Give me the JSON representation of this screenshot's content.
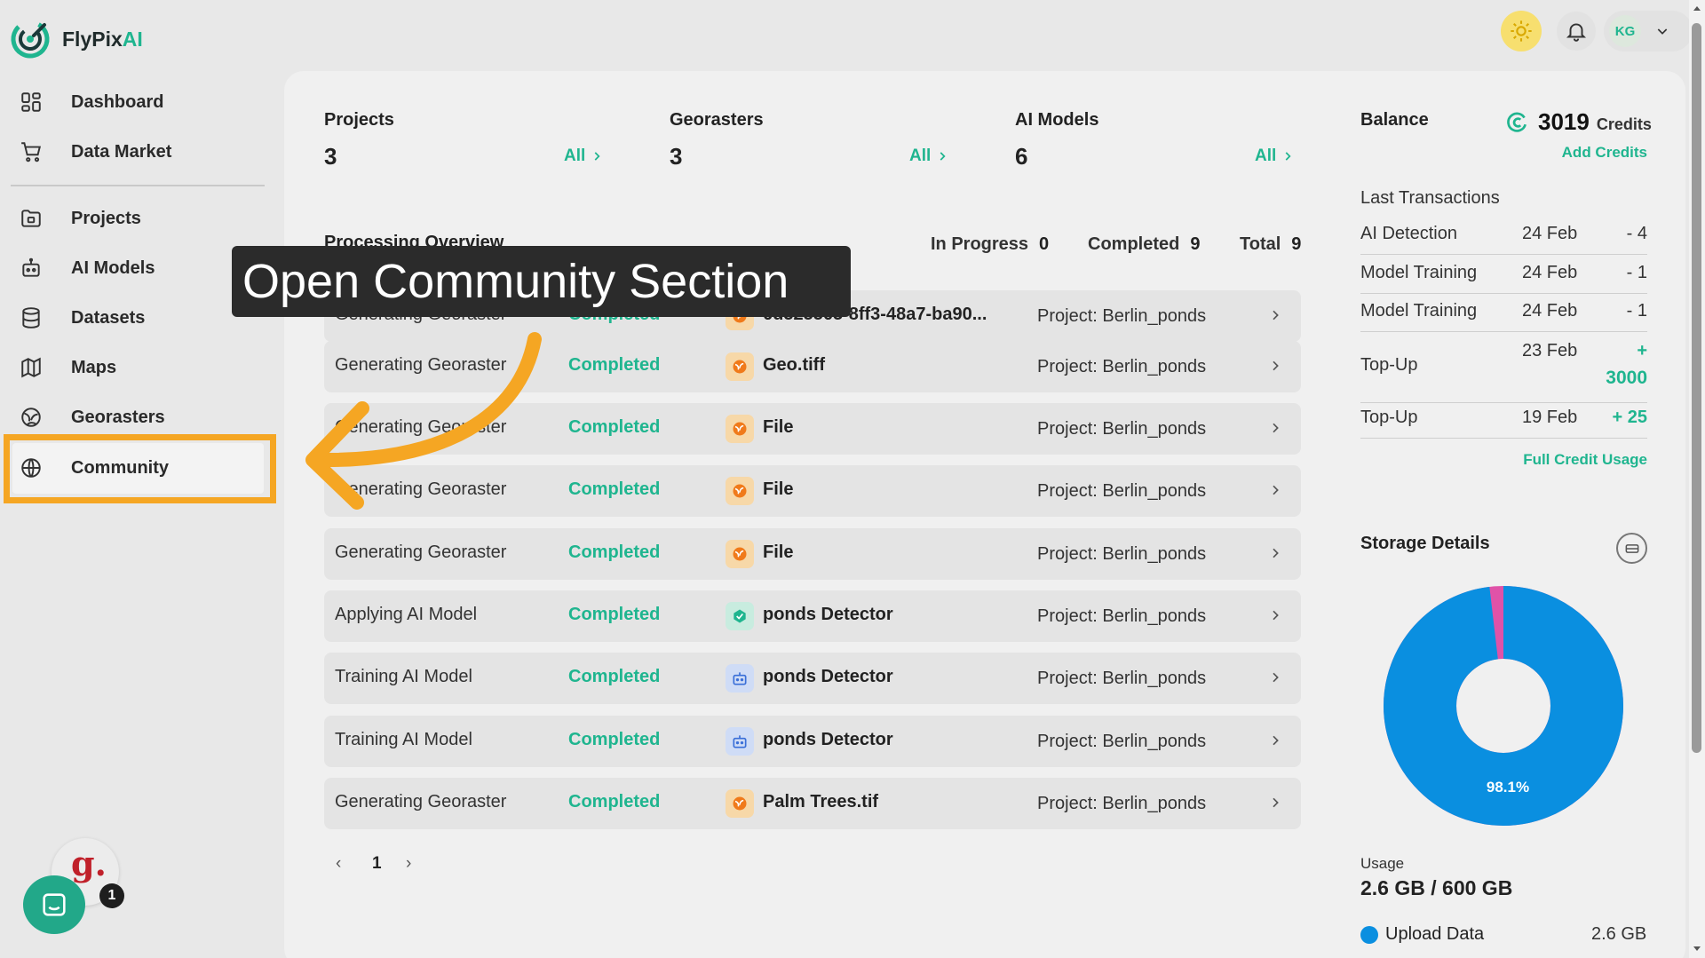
{
  "brand": {
    "name": "FlyPix",
    "name_ai": "AI"
  },
  "sidebar": {
    "items": [
      {
        "label": "Dashboard",
        "icon": "dashboard-icon"
      },
      {
        "label": "Data Market",
        "icon": "cart-icon"
      },
      {
        "label": "Projects",
        "icon": "folder-icon"
      },
      {
        "label": "AI Models",
        "icon": "robot-icon"
      },
      {
        "label": "Datasets",
        "icon": "database-icon"
      },
      {
        "label": "Maps",
        "icon": "map-icon"
      },
      {
        "label": "Georasters",
        "icon": "globe-grid-icon"
      },
      {
        "label": "Community",
        "icon": "globe-icon"
      }
    ]
  },
  "stats": [
    {
      "title": "Projects",
      "value": "3",
      "link": "All"
    },
    {
      "title": "Georasters",
      "value": "3",
      "link": "All"
    },
    {
      "title": "AI Models",
      "value": "6",
      "link": "All"
    }
  ],
  "processing": {
    "title": "Processing Overview",
    "in_progress_label": "In Progress",
    "in_progress": "0",
    "completed_label": "Completed",
    "completed": "9",
    "total_label": "Total",
    "total": "9",
    "rows": [
      {
        "task": "Generating Georaster",
        "status": "Completed",
        "file": "6d323363-8ff3-48a7-ba90...",
        "type": "georaster",
        "project": "Project: Berlin_ponds"
      },
      {
        "task": "Generating Georaster",
        "status": "Completed",
        "file": "Geo.tiff",
        "type": "georaster",
        "project": "Project: Berlin_ponds"
      },
      {
        "task": "Generating Georaster",
        "status": "Completed",
        "file": "File",
        "type": "georaster",
        "project": "Project: Berlin_ponds"
      },
      {
        "task": "Generating Georaster",
        "status": "Completed",
        "file": "File",
        "type": "georaster",
        "project": "Project: Berlin_ponds"
      },
      {
        "task": "Generating Georaster",
        "status": "Completed",
        "file": "File",
        "type": "georaster",
        "project": "Project: Berlin_ponds"
      },
      {
        "task": "Applying AI Model",
        "status": "Completed",
        "file": "ponds Detector",
        "type": "apply",
        "project": "Project: Berlin_ponds"
      },
      {
        "task": "Training AI Model",
        "status": "Completed",
        "file": "ponds Detector",
        "type": "train",
        "project": "Project: Berlin_ponds"
      },
      {
        "task": "Training AI Model",
        "status": "Completed",
        "file": "ponds Detector",
        "type": "train",
        "project": "Project: Berlin_ponds"
      },
      {
        "task": "Generating Georaster",
        "status": "Completed",
        "file": "Palm Trees.tif",
        "type": "georaster",
        "project": "Project: Berlin_ponds"
      }
    ],
    "page": "1"
  },
  "balance": {
    "title": "Balance",
    "value": "3019",
    "unit": "Credits",
    "add_label": "Add Credits",
    "last_tx_title": "Last Transactions",
    "transactions": [
      {
        "desc": "AI Detection",
        "date": "24 Feb",
        "amount": "- 4"
      },
      {
        "desc": "Model Training",
        "date": "24 Feb",
        "amount": "- 1"
      },
      {
        "desc": "Model Training",
        "date": "24 Feb",
        "amount": "- 1"
      },
      {
        "desc": "Top-Up",
        "date": "23 Feb",
        "amount": "+",
        "amount2": "3000"
      },
      {
        "desc": "Top-Up",
        "date": "19 Feb",
        "amount": "+ 25"
      }
    ],
    "full_usage_label": "Full Credit Usage"
  },
  "storage": {
    "title": "Storage Details",
    "percent_label": "98.1%",
    "used_fraction": 0.981,
    "usage_label": "Usage",
    "usage_value": "2.6 GB / 600 GB",
    "legend_label": "Upload Data",
    "legend_value": "2.6 GB",
    "colors": {
      "main": "#0a8fe0",
      "other": "#e052a8"
    }
  },
  "user": {
    "initials": "KG"
  },
  "callout": {
    "text": "Open Community Section"
  },
  "chat": {
    "badge": "1",
    "g_letter": "g."
  },
  "colors": {
    "accent": "#1fb58f",
    "highlight": "#f5a623"
  }
}
